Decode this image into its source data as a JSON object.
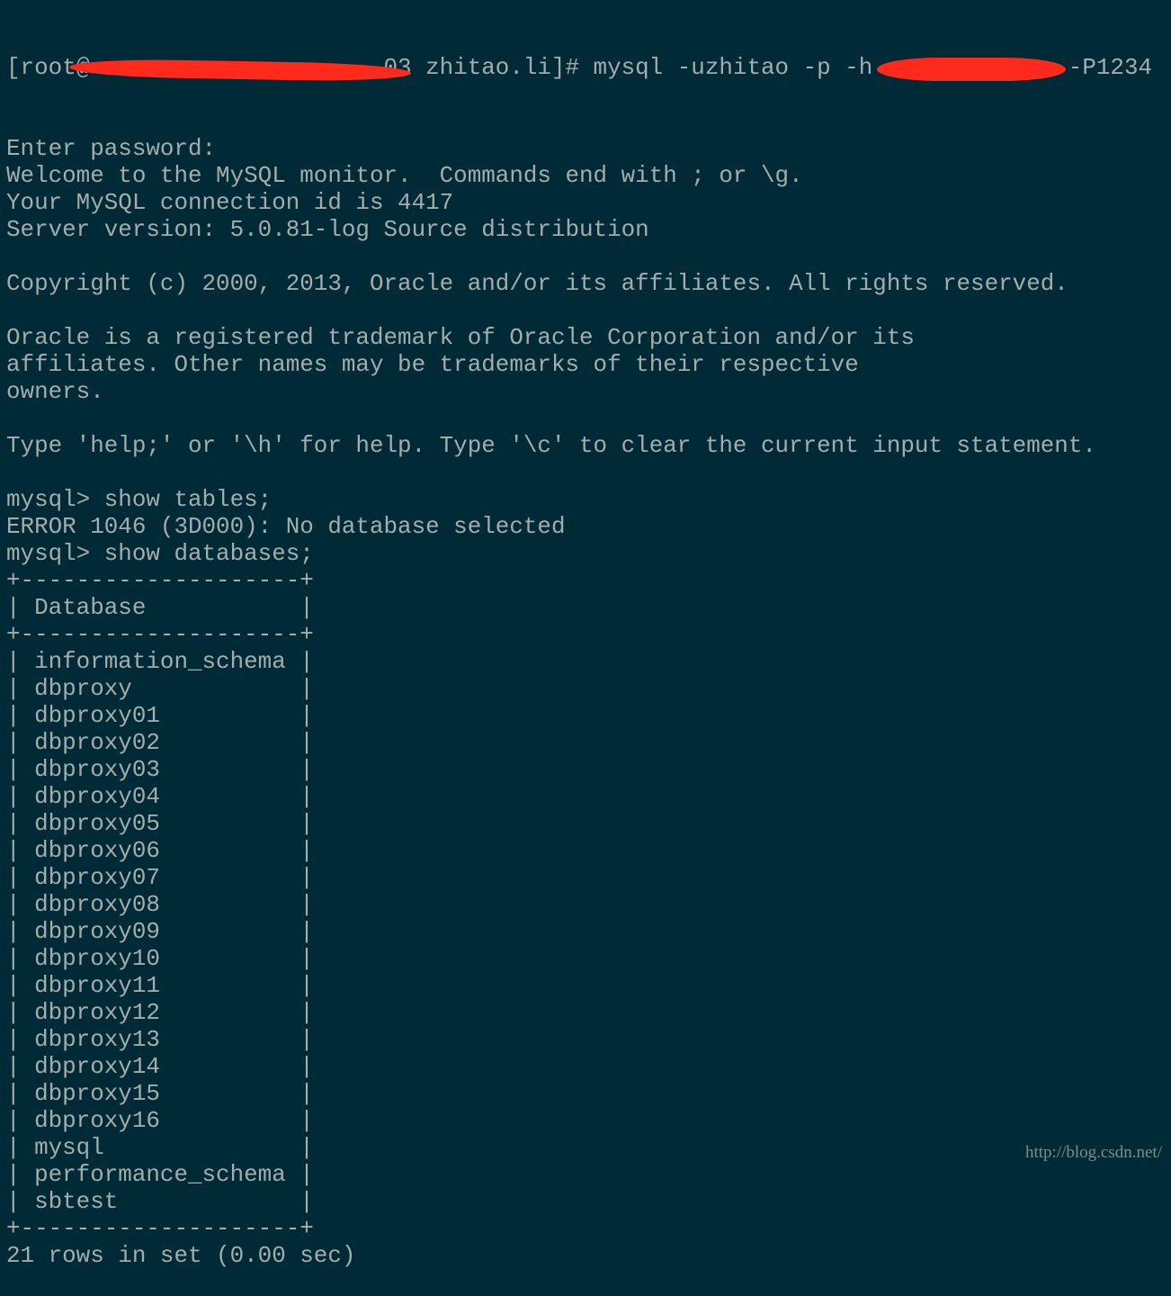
{
  "terminal": {
    "colors": {
      "background": "#002b36",
      "text": "#a3adad",
      "redaction": "#ff2a1c"
    },
    "first_line": {
      "prompt_start": "[root@",
      "prompt_rest": "03 zhitao.li]# mysql -uzhitao -p -h",
      "port_arg": "-P1234"
    },
    "lines": [
      "Enter password:",
      "Welcome to the MySQL monitor.  Commands end with ; or \\g.",
      "Your MySQL connection id is 4417",
      "Server version: 5.0.81-log Source distribution",
      "",
      "Copyright (c) 2000, 2013, Oracle and/or its affiliates. All rights reserved.",
      "",
      "Oracle is a registered trademark of Oracle Corporation and/or its",
      "affiliates. Other names may be trademarks of their respective",
      "owners.",
      "",
      "Type 'help;' or '\\h' for help. Type '\\c' to clear the current input statement.",
      "",
      "mysql> show tables;",
      "ERROR 1046 (3D000): No database selected",
      "mysql> show databases;",
      "+--------------------+",
      "| Database           |",
      "+--------------------+",
      "| information_schema |",
      "| dbproxy            |",
      "| dbproxy01          |",
      "| dbproxy02          |",
      "| dbproxy03          |",
      "| dbproxy04          |",
      "| dbproxy05          |",
      "| dbproxy06          |",
      "| dbproxy07          |",
      "| dbproxy08          |",
      "| dbproxy09          |",
      "| dbproxy10          |",
      "| dbproxy11          |",
      "| dbproxy12          |",
      "| dbproxy13          |",
      "| dbproxy14          |",
      "| dbproxy15          |",
      "| dbproxy16          |",
      "| mysql              |",
      "| performance_schema |",
      "| sbtest             |",
      "+--------------------+",
      "21 rows in set (0.00 sec)"
    ]
  },
  "watermark": "http://blog.csdn.net/"
}
